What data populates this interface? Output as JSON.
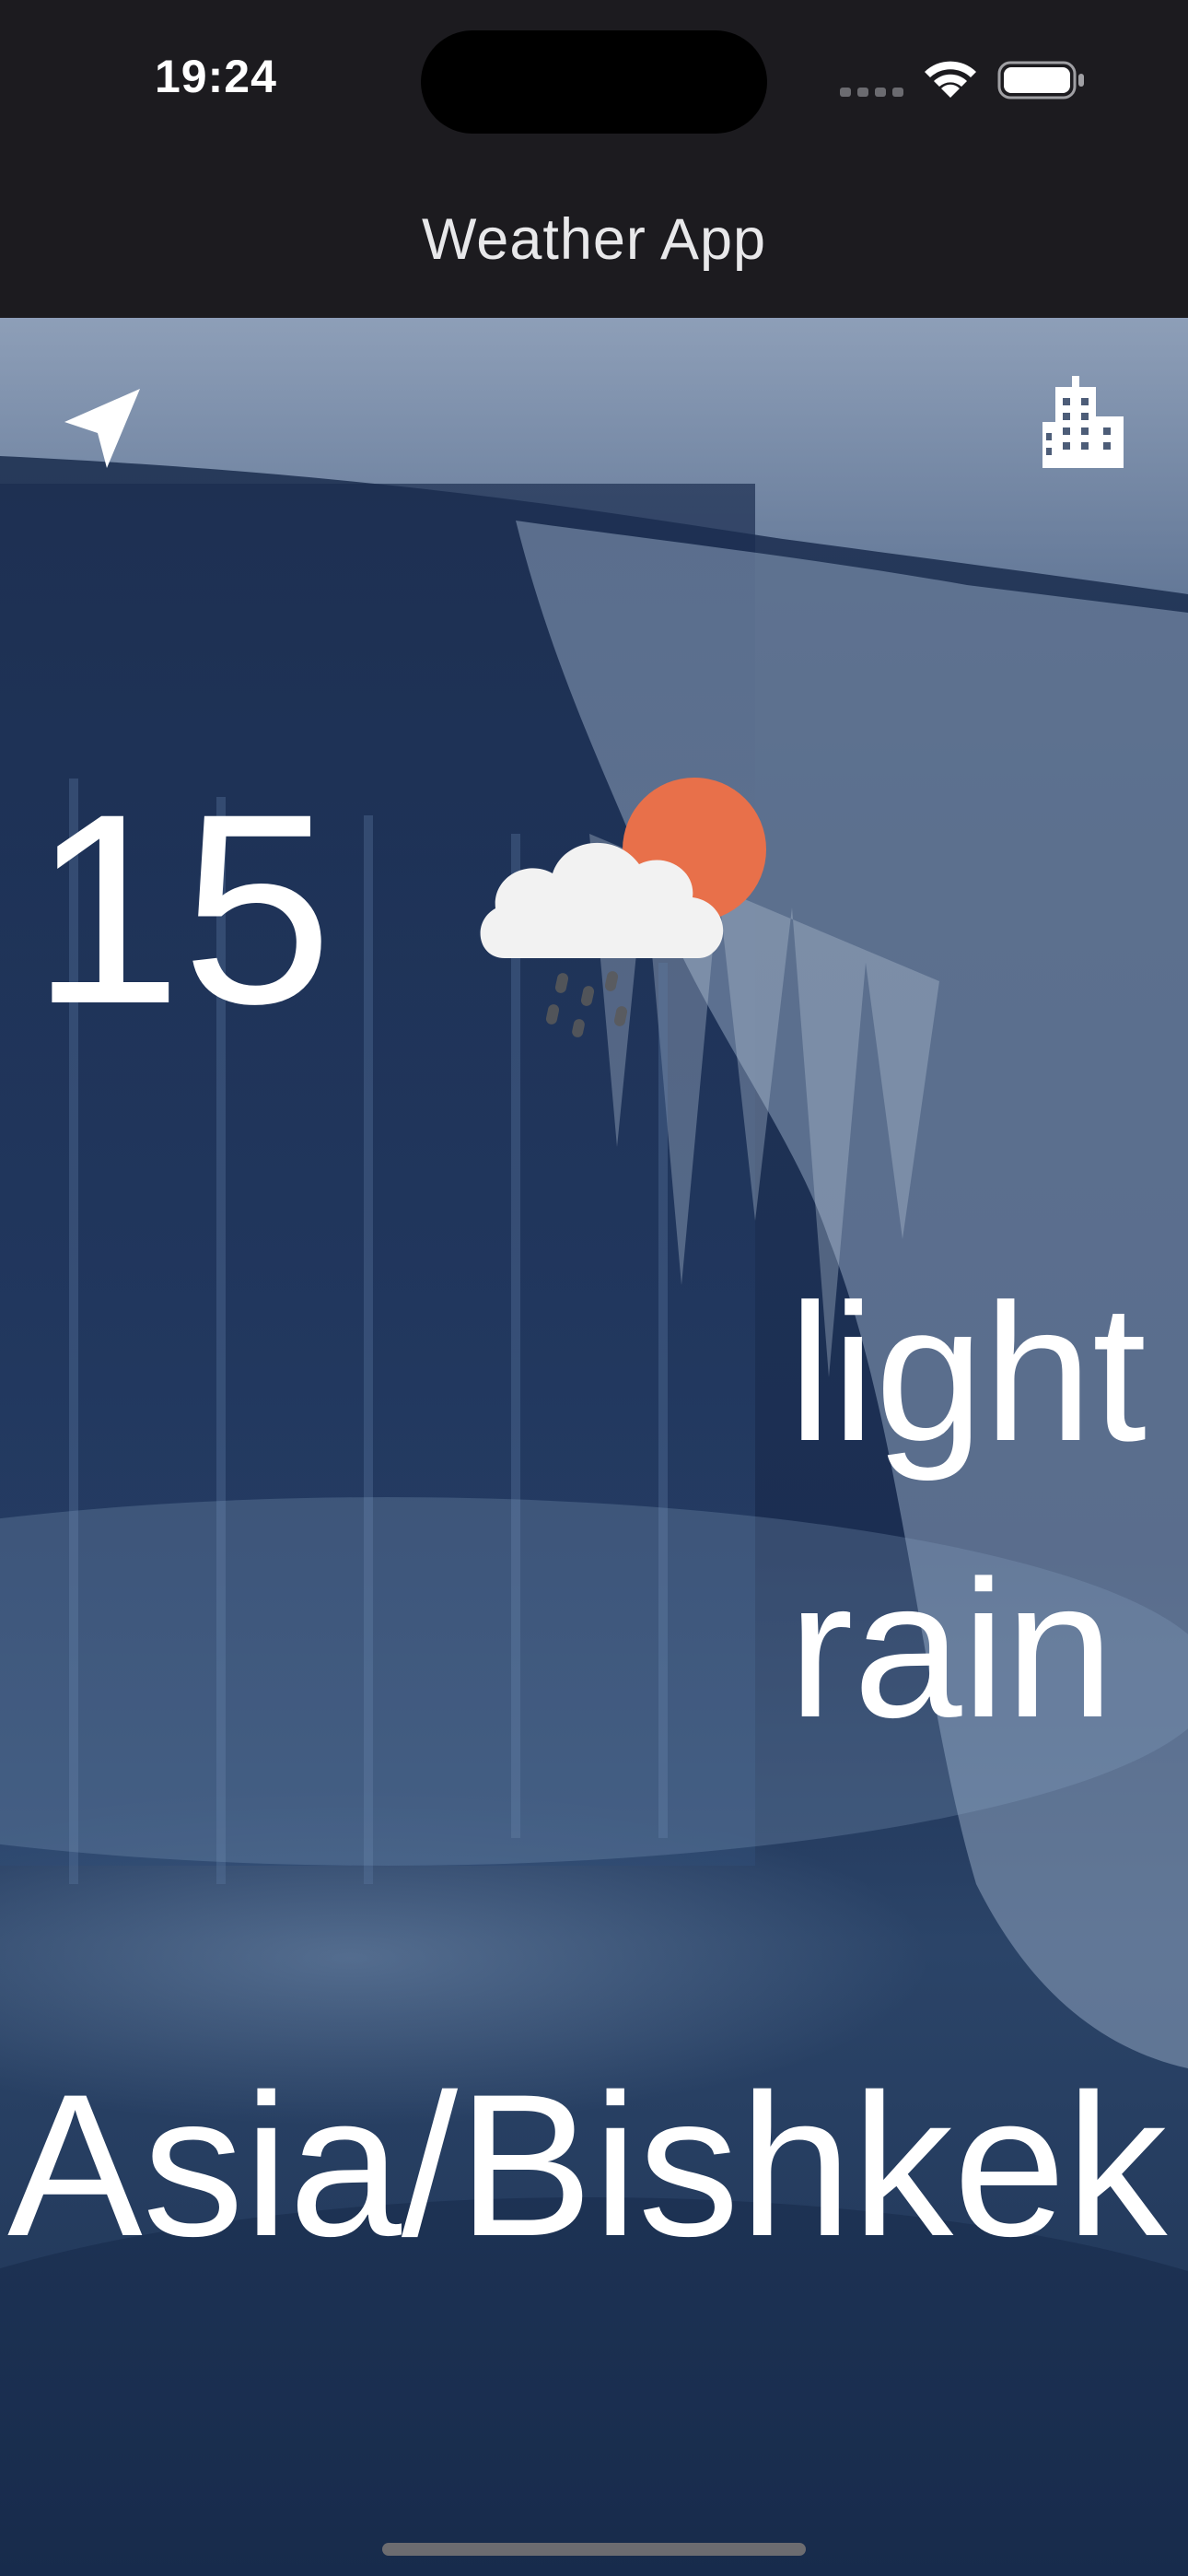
{
  "status_bar": {
    "time": "19:24"
  },
  "app_bar": {
    "title": "Weather App"
  },
  "weather": {
    "temperature": "15",
    "description": "light rain",
    "timezone": "Asia/Bishkek",
    "condition_icon": "cloud-sun-rain-icon"
  },
  "icons": {
    "location": "location-arrow-icon",
    "city": "city-icon"
  },
  "colors": {
    "app_bar_bg": "#1c1b1f",
    "text": "#ffffff",
    "sun": "#e8704a",
    "cloud": "#f2f2f2"
  }
}
